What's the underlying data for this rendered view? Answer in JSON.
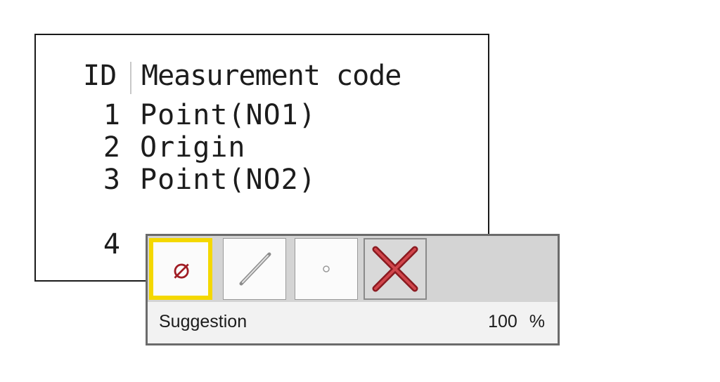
{
  "list": {
    "header": {
      "id_label": "ID",
      "name_label": "Measurement code"
    },
    "rows": [
      {
        "id": "1",
        "name": "Point(NO1)"
      },
      {
        "id": "2",
        "name": "Origin"
      },
      {
        "id": "3",
        "name": "Point(NO2)"
      },
      {
        "id": "4",
        "name": ""
      }
    ]
  },
  "popup": {
    "tools": [
      {
        "name": "diameter",
        "icon": "diameter-icon",
        "glyph": "⌀",
        "selected": true
      },
      {
        "name": "line",
        "icon": "line-icon",
        "selected": false
      },
      {
        "name": "point",
        "icon": "point-icon",
        "selected": false
      },
      {
        "name": "cancel",
        "icon": "close-icon",
        "selected": false
      }
    ],
    "status": {
      "label": "Suggestion",
      "value": "100 %"
    }
  },
  "colors": {
    "selection_highlight": "#f4d800",
    "diameter_red": "#a01c24",
    "cancel_red": "#c0262e"
  }
}
